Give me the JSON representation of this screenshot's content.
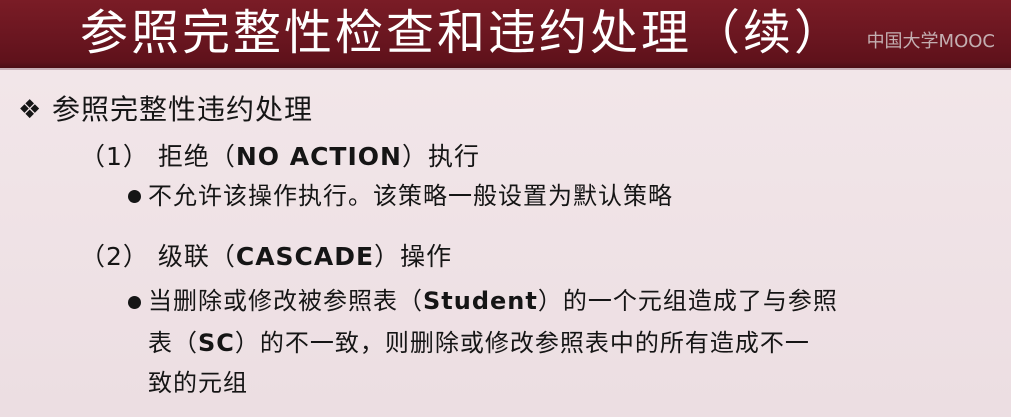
{
  "header": {
    "title": "参照完整性检查和违约处理（续）",
    "watermark": "中国大学MOOC"
  },
  "content": {
    "heading_marker": "❖",
    "heading": "参照完整性违约处理",
    "item1": {
      "prefix": "（1） 拒绝（",
      "keyword": "NO ACTION",
      "suffix": "）执行",
      "bullet": "不允许该操作执行。该策略一般设置为默认策略"
    },
    "item2": {
      "prefix": "（2） 级联（",
      "keyword": "CASCADE",
      "suffix": "）操作",
      "bullet_line1_a": "当删除或修改被参照表（",
      "bullet_line1_keyword": "Student",
      "bullet_line1_b": "）的一个元组造成了与参照",
      "bullet_line2_a": "表（",
      "bullet_line2_keyword": "SC",
      "bullet_line2_b": "）的不一致，则删除或修改参照表中的所有造成不一",
      "bullet_line3": "致的元组"
    }
  }
}
